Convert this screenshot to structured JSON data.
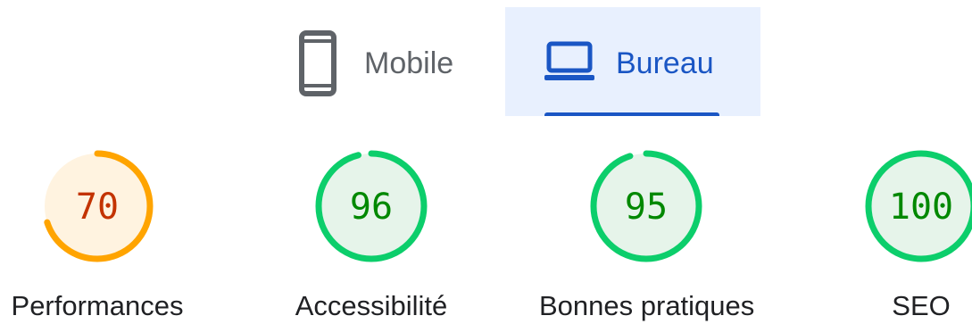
{
  "device_tabs": [
    {
      "label": "Mobile",
      "icon": "mobile-phone-icon",
      "selected": false
    },
    {
      "label": "Bureau",
      "icon": "laptop-icon",
      "selected": true
    }
  ],
  "scores": [
    {
      "label": "Performances",
      "value": "70",
      "fraction": 0.7,
      "ring_color": "#ffa400",
      "fill_color": "#fff3e0",
      "text_color": "#c33300"
    },
    {
      "label": "Accessibilité",
      "value": "96",
      "fraction": 0.96,
      "ring_color": "#0cce6b",
      "fill_color": "#e6f4ea",
      "text_color": "#008800"
    },
    {
      "label": "Bonnes pratiques",
      "value": "95",
      "fraction": 0.95,
      "ring_color": "#0cce6b",
      "fill_color": "#e6f4ea",
      "text_color": "#008800"
    },
    {
      "label": "SEO",
      "value": "100",
      "fraction": 1.0,
      "ring_color": "#0cce6b",
      "fill_color": "#e6f4ea",
      "text_color": "#008800"
    }
  ]
}
